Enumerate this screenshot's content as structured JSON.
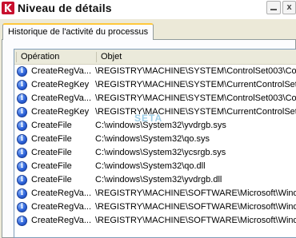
{
  "window": {
    "title": "Niveau de détails",
    "icon": "kaspersky-k-icon",
    "close_label": "x"
  },
  "tabs": [
    {
      "label": "Historique de l'activité du processus",
      "selected": true
    }
  ],
  "table": {
    "columns": [
      "Opération",
      "Objet"
    ],
    "rows": [
      {
        "icon": "info-icon",
        "operation": "CreateRegVa...",
        "object": "\\REGISTRY\\MACHINE\\SYSTEM\\ControlSet003\\Con"
      },
      {
        "icon": "info-icon",
        "operation": "CreateRegKey",
        "object": "\\REGISTRY\\MACHINE\\SYSTEM\\CurrentControlSet\\"
      },
      {
        "icon": "info-icon",
        "operation": "CreateRegVa...",
        "object": "\\REGISTRY\\MACHINE\\SYSTEM\\ControlSet003\\Con"
      },
      {
        "icon": "info-icon",
        "operation": "CreateRegKey",
        "object": "\\REGISTRY\\MACHINE\\SYSTEM\\CurrentControlSet\\"
      },
      {
        "icon": "info-icon",
        "operation": "CreateFile",
        "object": "C:\\windows\\System32\\yvdrgb.sys"
      },
      {
        "icon": "info-icon",
        "operation": "CreateFile",
        "object": "C:\\windows\\System32\\qo.sys"
      },
      {
        "icon": "info-icon",
        "operation": "CreateFile",
        "object": "C:\\windows\\System32\\ycsrgb.sys"
      },
      {
        "icon": "info-icon",
        "operation": "CreateFile",
        "object": "C:\\windows\\System32\\qo.dll"
      },
      {
        "icon": "info-icon",
        "operation": "CreateFile",
        "object": "C:\\windows\\System32\\yvdrgb.dll"
      },
      {
        "icon": "info-icon",
        "operation": "CreateRegVa...",
        "object": "\\REGISTRY\\MACHINE\\SOFTWARE\\Microsoft\\Windo"
      },
      {
        "icon": "info-icon",
        "operation": "CreateRegVa...",
        "object": "\\REGISTRY\\MACHINE\\SOFTWARE\\Microsoft\\Windo"
      },
      {
        "icon": "info-icon",
        "operation": "CreateRegVa...",
        "object": "\\REGISTRY\\MACHINE\\SOFTWARE\\Microsoft\\Windo"
      }
    ]
  },
  "watermark": "SETA",
  "colors": {
    "tab_highlight": "#ffc83c",
    "info_icon": "#2a5fd6",
    "header_bg": "#ebeadb",
    "window_bg": "#ece9d8"
  }
}
